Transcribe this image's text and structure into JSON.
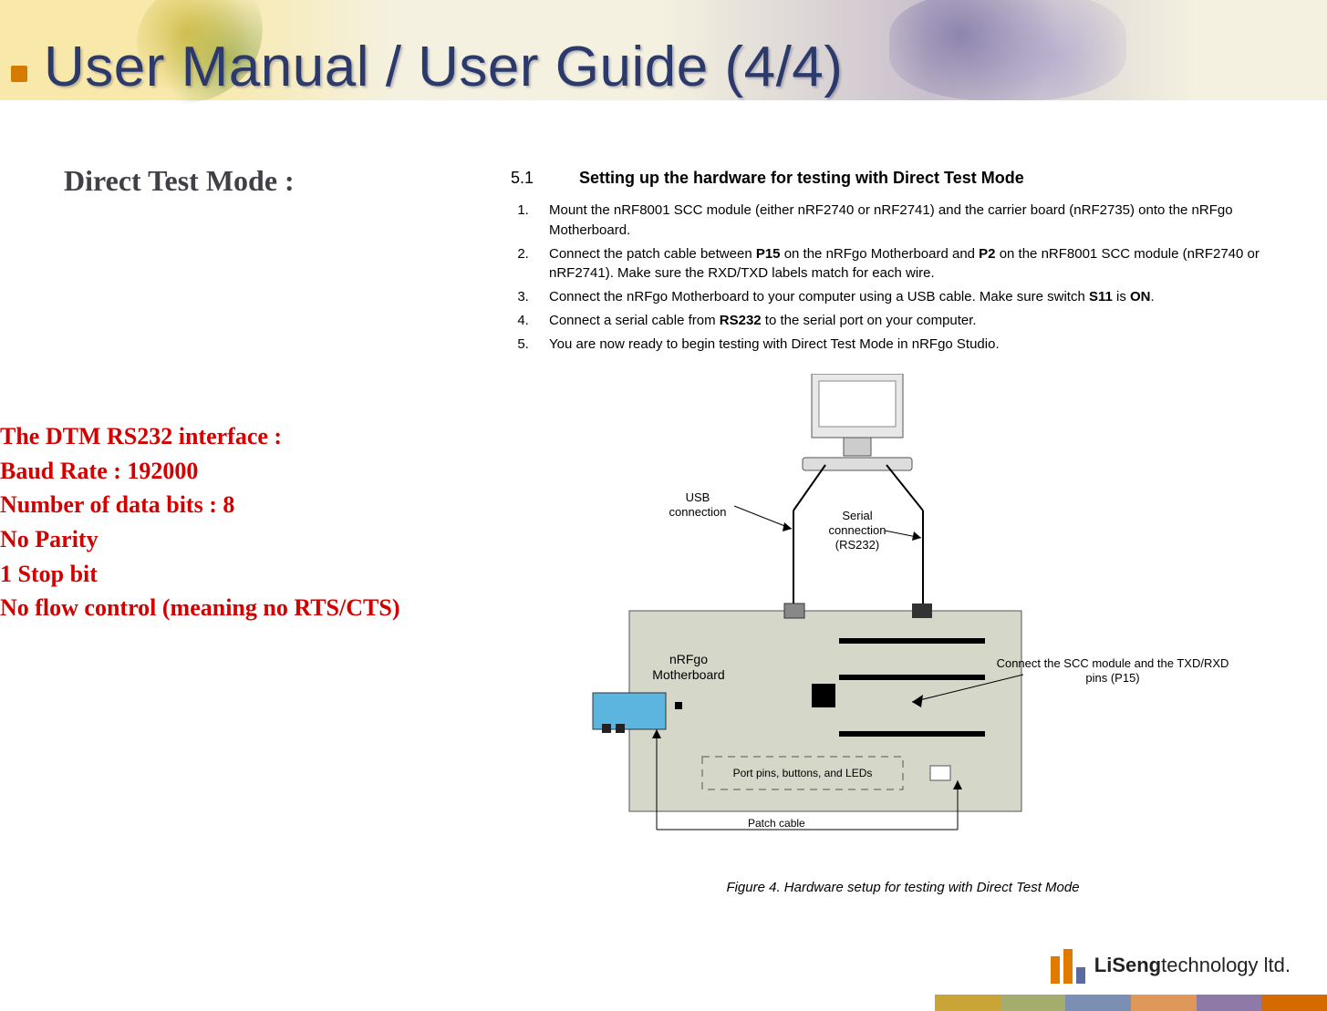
{
  "title": "User Manual / User Guide (4/4)",
  "subtitle": "Direct Test Mode :",
  "dtm_interface": {
    "heading": "The DTM RS232 interface :",
    "lines": [
      "Baud Rate : 192000",
      "Number of data bits : 8",
      "No Parity",
      "1 Stop bit",
      "No flow control (meaning no RTS/CTS)"
    ]
  },
  "doc": {
    "section_number": "5.1",
    "section_title": "Setting up the hardware for testing with Direct Test Mode",
    "steps": [
      {
        "pre": "Mount the nRF8001 SCC module (either nRF2740 or nRF2741) and the carrier board (nRF2735) onto the nRFgo Motherboard."
      },
      {
        "pre": "Connect the patch cable between ",
        "b1": "P15",
        "mid1": " on the nRFgo Motherboard and ",
        "b2": "P2",
        "mid2": " on the nRF8001 SCC module (nRF2740 or nRF2741). Make sure the RXD/TXD labels match for each wire."
      },
      {
        "pre": "Connect the nRFgo Motherboard to your computer using a USB cable. Make sure switch ",
        "b1": "S11",
        "mid1": " is ",
        "b2": "ON",
        "mid2": "."
      },
      {
        "pre": "Connect a serial cable from ",
        "b1": "RS232",
        "mid1": " to the serial port on your computer."
      },
      {
        "pre": "You are now ready to begin testing with Direct Test Mode in nRFgo Studio."
      }
    ]
  },
  "diagram_labels": {
    "usb": "USB\nconnection",
    "serial": "Serial\nconnection\n(RS232)",
    "mobo": "nRFgo\nMotherboard",
    "scc": "Connect the SCC module and the TXD/RXD\npins (P15)",
    "port_pins": "Port pins, buttons, and LEDs",
    "patch": "Patch cable"
  },
  "figure_caption": "Figure 4. Hardware setup for testing with Direct Test Mode",
  "footer_company_bold": "LiSeng",
  "footer_company_rest": " technology ltd."
}
